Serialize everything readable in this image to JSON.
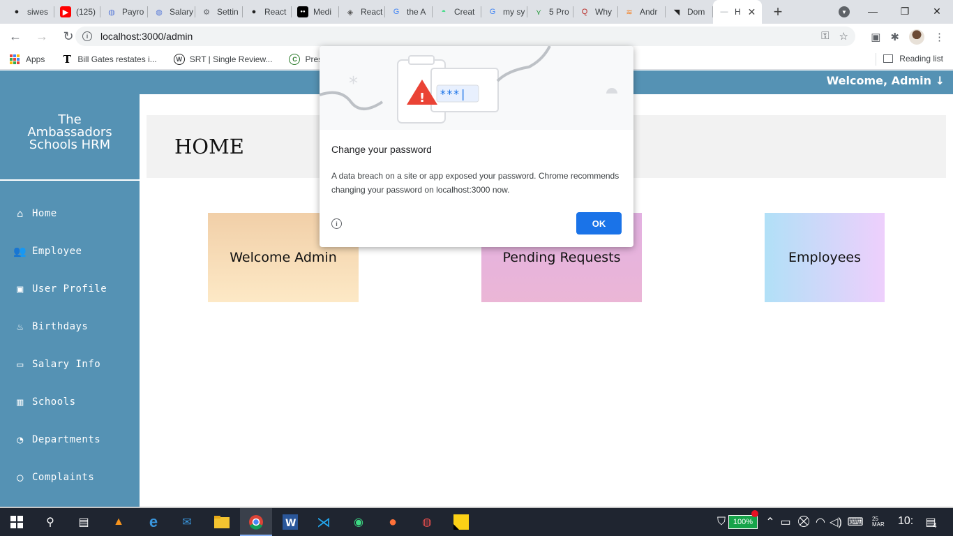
{
  "browser": {
    "tabs": [
      {
        "label": "siwes",
        "icon": "github-icon"
      },
      {
        "label": "(125)",
        "icon": "youtube-icon"
      },
      {
        "label": "Payro",
        "icon": "globe-icon"
      },
      {
        "label": "Salary",
        "icon": "globe-icon"
      },
      {
        "label": "Settin",
        "icon": "chrome-settings-icon"
      },
      {
        "label": "React",
        "icon": "github-icon"
      },
      {
        "label": "Medi",
        "icon": "medium-icon"
      },
      {
        "label": "React",
        "icon": "react-icon"
      },
      {
        "label": "the A",
        "icon": "google-icon"
      },
      {
        "label": "Creat",
        "icon": "android-icon"
      },
      {
        "label": "my sy",
        "icon": "google-icon"
      },
      {
        "label": "5 Pro",
        "icon": "bitbucket-icon"
      },
      {
        "label": "Why",
        "icon": "quora-icon"
      },
      {
        "label": "Andr",
        "icon": "stackoverflow-icon"
      },
      {
        "label": "Dom",
        "icon": "rss-icon"
      },
      {
        "label": "H",
        "icon": "loading-icon",
        "active": true
      }
    ],
    "address": "localhost:3000/admin",
    "bookmarks": [
      {
        "label": "Apps"
      },
      {
        "label": "Bill Gates restates i..."
      },
      {
        "label": "SRT | Single Review..."
      },
      {
        "label": "Presiden"
      }
    ],
    "reading_list": "Reading list"
  },
  "app": {
    "welcome": "Welcome, Admin",
    "welcome_arrow": "↓",
    "brand": [
      "The",
      "Ambassadors",
      "Schools HRM"
    ],
    "nav": [
      {
        "label": "Home",
        "icon": "home-icon",
        "glyph": "⌂"
      },
      {
        "label": "Employee",
        "icon": "users-icon",
        "glyph": "👥"
      },
      {
        "label": "User Profile",
        "icon": "briefcase-icon",
        "glyph": "▣"
      },
      {
        "label": "Birthdays",
        "icon": "cake-icon",
        "glyph": "♨"
      },
      {
        "label": "Salary Info",
        "icon": "money-icon",
        "glyph": "▭"
      },
      {
        "label": "Schools",
        "icon": "school-icon",
        "glyph": "▥"
      },
      {
        "label": "Departments",
        "icon": "dashboard-icon",
        "glyph": "◔"
      },
      {
        "label": "Complaints",
        "icon": "comment-icon",
        "glyph": "◯"
      }
    ],
    "page_title": "HOME",
    "cards": [
      "Welcome Admin",
      "Pending Requests",
      "Employees"
    ]
  },
  "dialog": {
    "title": "Change your password",
    "body": "A data breach on a site or app exposed your password. Chrome recommends changing your password on localhost:3000 now.",
    "ok": "OK",
    "masked": "***|"
  },
  "taskbar": {
    "battery": "100%",
    "date": "25 MAR",
    "time": "10:",
    "notifications": "4"
  }
}
